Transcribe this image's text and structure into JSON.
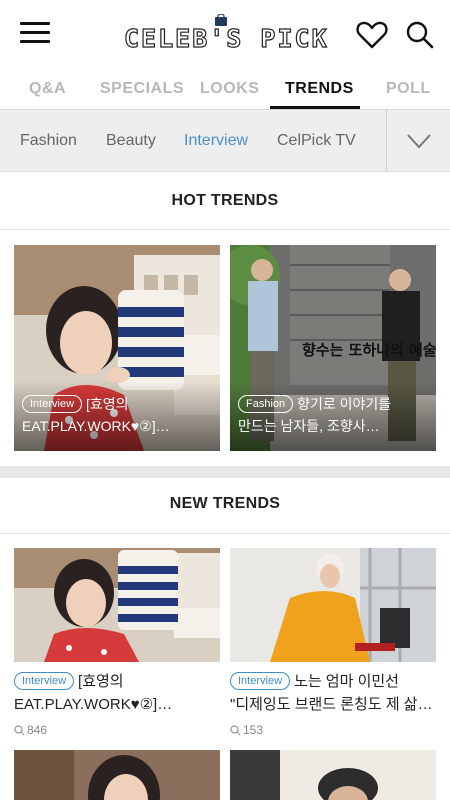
{
  "header": {
    "logo_text": "CELEB'S PICK"
  },
  "tabs": [
    {
      "label": "Q&A"
    },
    {
      "label": "SPECIALS"
    },
    {
      "label": "LOOKS"
    },
    {
      "label": "TRENDS"
    },
    {
      "label": "POLL"
    }
  ],
  "subcategories": [
    {
      "label": "Fashion"
    },
    {
      "label": "Beauty"
    },
    {
      "label": "Interview"
    },
    {
      "label": "CelPick TV"
    }
  ],
  "hot_trends": {
    "title": "HOT TRENDS",
    "cards": [
      {
        "category": "Interview",
        "line1": "[효영의",
        "line2": "EAT.PLAY.WORK♥②]…"
      },
      {
        "category": "Fashion",
        "line1": "향기로 이야기를",
        "line2": "만드는 남자들, 조향사…",
        "image_caption": "향수는 또하나의 예술이다"
      }
    ]
  },
  "new_trends": {
    "title": "NEW TRENDS",
    "cards": [
      {
        "category": "Interview",
        "line1": "[효영의",
        "line2": "EAT.PLAY.WORK♥②]…",
        "views": "846"
      },
      {
        "category": "Interview",
        "line1": "노는 엄마 이민선",
        "line2": "\"디제잉도 브랜드 론칭도 제 삶…",
        "views": "153"
      }
    ]
  },
  "colors": {
    "accent": "#3f8cc6",
    "tab_active": "#111111",
    "tab_inactive": "#b8b8b8"
  }
}
